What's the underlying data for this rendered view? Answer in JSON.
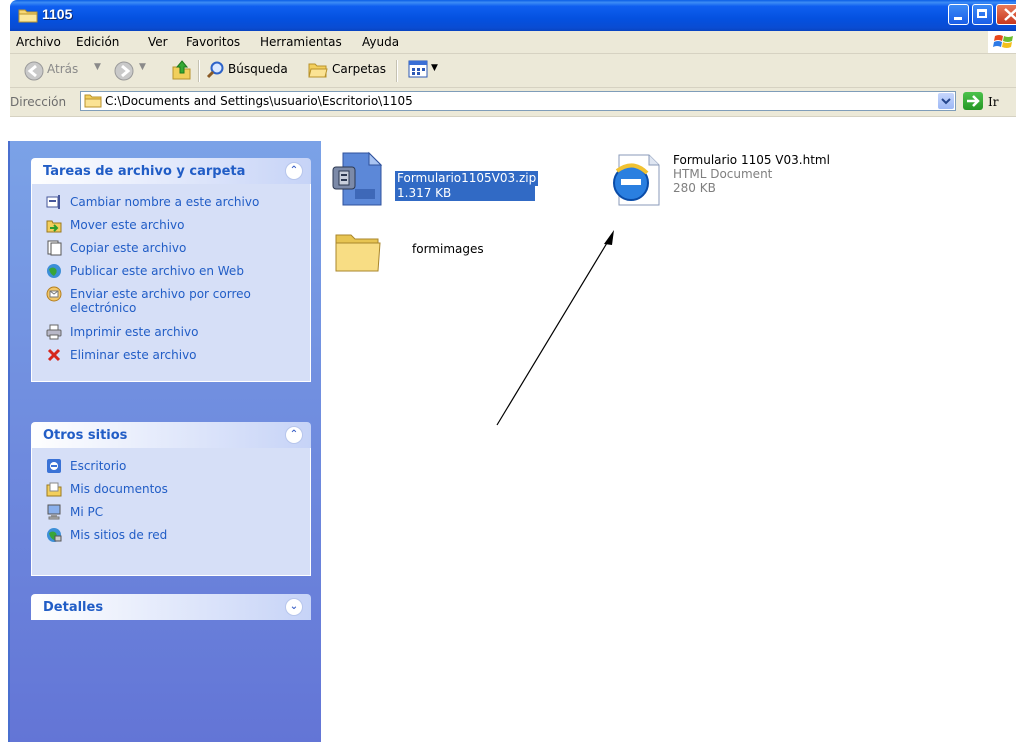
{
  "window": {
    "title": "1105"
  },
  "menu": [
    "Archivo",
    "Edición",
    "Ver",
    "Favoritos",
    "Herramientas",
    "Ayuda"
  ],
  "toolbar": {
    "back": "Atrás",
    "search": "Búsqueda",
    "folders": "Carpetas"
  },
  "address": {
    "label": "Dirección",
    "path": "C:\\Documents and Settings\\usuario\\Escritorio\\1105",
    "go": "Ir"
  },
  "tasks_panel": {
    "title": "Tareas de archivo y carpeta",
    "items": [
      {
        "label": "Cambiar nombre a este archivo",
        "icon": "rename-icon"
      },
      {
        "label": "Mover este archivo",
        "icon": "move-icon"
      },
      {
        "label": "Copiar este archivo",
        "icon": "copy-icon"
      },
      {
        "label": "Publicar este archivo en Web",
        "icon": "publish-web-icon"
      },
      {
        "label": "Enviar este archivo por correo electrónico",
        "icon": "email-icon"
      },
      {
        "label": "Imprimir este archivo",
        "icon": "printer-icon"
      },
      {
        "label": "Eliminar este archivo",
        "icon": "delete-icon"
      }
    ]
  },
  "places_panel": {
    "title": "Otros sitios",
    "items": [
      {
        "label": "Escritorio",
        "icon": "desktop-icon"
      },
      {
        "label": "Mis documentos",
        "icon": "my-documents-icon"
      },
      {
        "label": "Mi PC",
        "icon": "my-computer-icon"
      },
      {
        "label": "Mis sitios de red",
        "icon": "network-places-icon"
      }
    ]
  },
  "details_panel": {
    "title": "Detalles"
  },
  "files": [
    {
      "name": "Formulario1105V03.zip",
      "size": "1.317 KB",
      "icon": "zip-archive-icon",
      "selected": true
    },
    {
      "name": "Formulario 1105 V03.html",
      "type": "HTML Document",
      "size": "280 KB",
      "icon": "internet-explorer-icon"
    },
    {
      "name": "formimages",
      "icon": "folder-icon"
    }
  ],
  "colors": {
    "titlebar": "#0a54e3",
    "selection": "#316ac5",
    "pane_link": "#215dc6",
    "pane_bg": "#7ba2e7"
  }
}
